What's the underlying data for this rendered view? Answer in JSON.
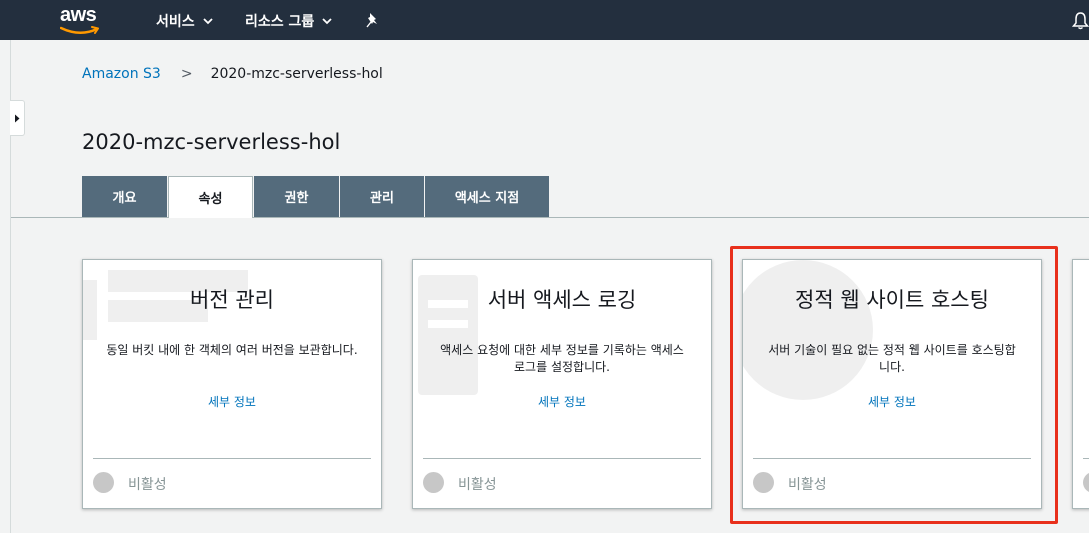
{
  "nav": {
    "logo_text": "aws",
    "services_label": "서비스",
    "resource_groups_label": "리소스 그룹",
    "pin_icon": "pushpin-icon",
    "bell_icon": "bell-icon",
    "bg_color": "#232f3e"
  },
  "breadcrumb": {
    "root": "Amazon S3",
    "separator": ">",
    "current": "2020-mzc-serverless-hol"
  },
  "page_title": "2020-mzc-serverless-hol",
  "tabs": [
    {
      "label": "개요",
      "active": false
    },
    {
      "label": "속성",
      "active": true
    },
    {
      "label": "권한",
      "active": false
    },
    {
      "label": "관리",
      "active": false
    },
    {
      "label": "액세스 지점",
      "active": false
    }
  ],
  "cards": [
    {
      "title": "버전 관리",
      "description": "동일 버킷 내에 한 객체의 여러 버전을 보관합니다.",
      "more_link": "세부 정보",
      "status": "비활성"
    },
    {
      "title": "서버 액세스 로깅",
      "description": "액세스 요청에 대한 세부 정보를 기록하는 액세스 로그를 설정합니다.",
      "more_link": "세부 정보",
      "status": "비활성"
    },
    {
      "title": "정적 웹 사이트 호스팅",
      "description": "서버 기술이 필요 없는 정적 웹 사이트를 호스팅합니다.",
      "more_link": "세부 정보",
      "status": "비활성"
    }
  ],
  "colors": {
    "tab_inactive": "#546b7c",
    "link": "#0073bb",
    "highlight": "#e8301c"
  }
}
